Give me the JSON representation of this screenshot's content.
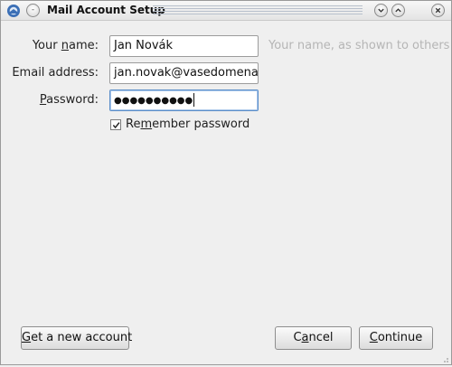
{
  "window": {
    "title": "Mail Account Setup",
    "menu_glyph": "-"
  },
  "form": {
    "name_label_pre": "Your ",
    "name_label_acc": "n",
    "name_label_post": "ame:",
    "name_value": "Jan Novák",
    "name_hint": "Your name, as shown to others",
    "email_label_pre": "",
    "email_label_acc": "",
    "email_label_post": "Email address:",
    "email_value": "jan.novak@vasedomena.c",
    "password_label_pre": "",
    "password_label_acc": "P",
    "password_label_post": "assword:",
    "password_value": "●●●●●●●●●●",
    "remember_label_pre": "Re",
    "remember_label_acc": "m",
    "remember_label_post": "ember password",
    "remember_checked": true
  },
  "buttons": {
    "new_account_acc": "G",
    "new_account_post": "et a new account",
    "cancel_pre": "C",
    "cancel_acc": "a",
    "cancel_post": "ncel",
    "continue_acc": "C",
    "continue_post": "ontinue"
  },
  "icons": {
    "app": "thunderbird-icon",
    "menu": "window-menu-icon",
    "minimize": "minimize-icon",
    "maximize": "maximize-icon",
    "close": "close-icon",
    "checkbox": "checkmark-icon"
  }
}
